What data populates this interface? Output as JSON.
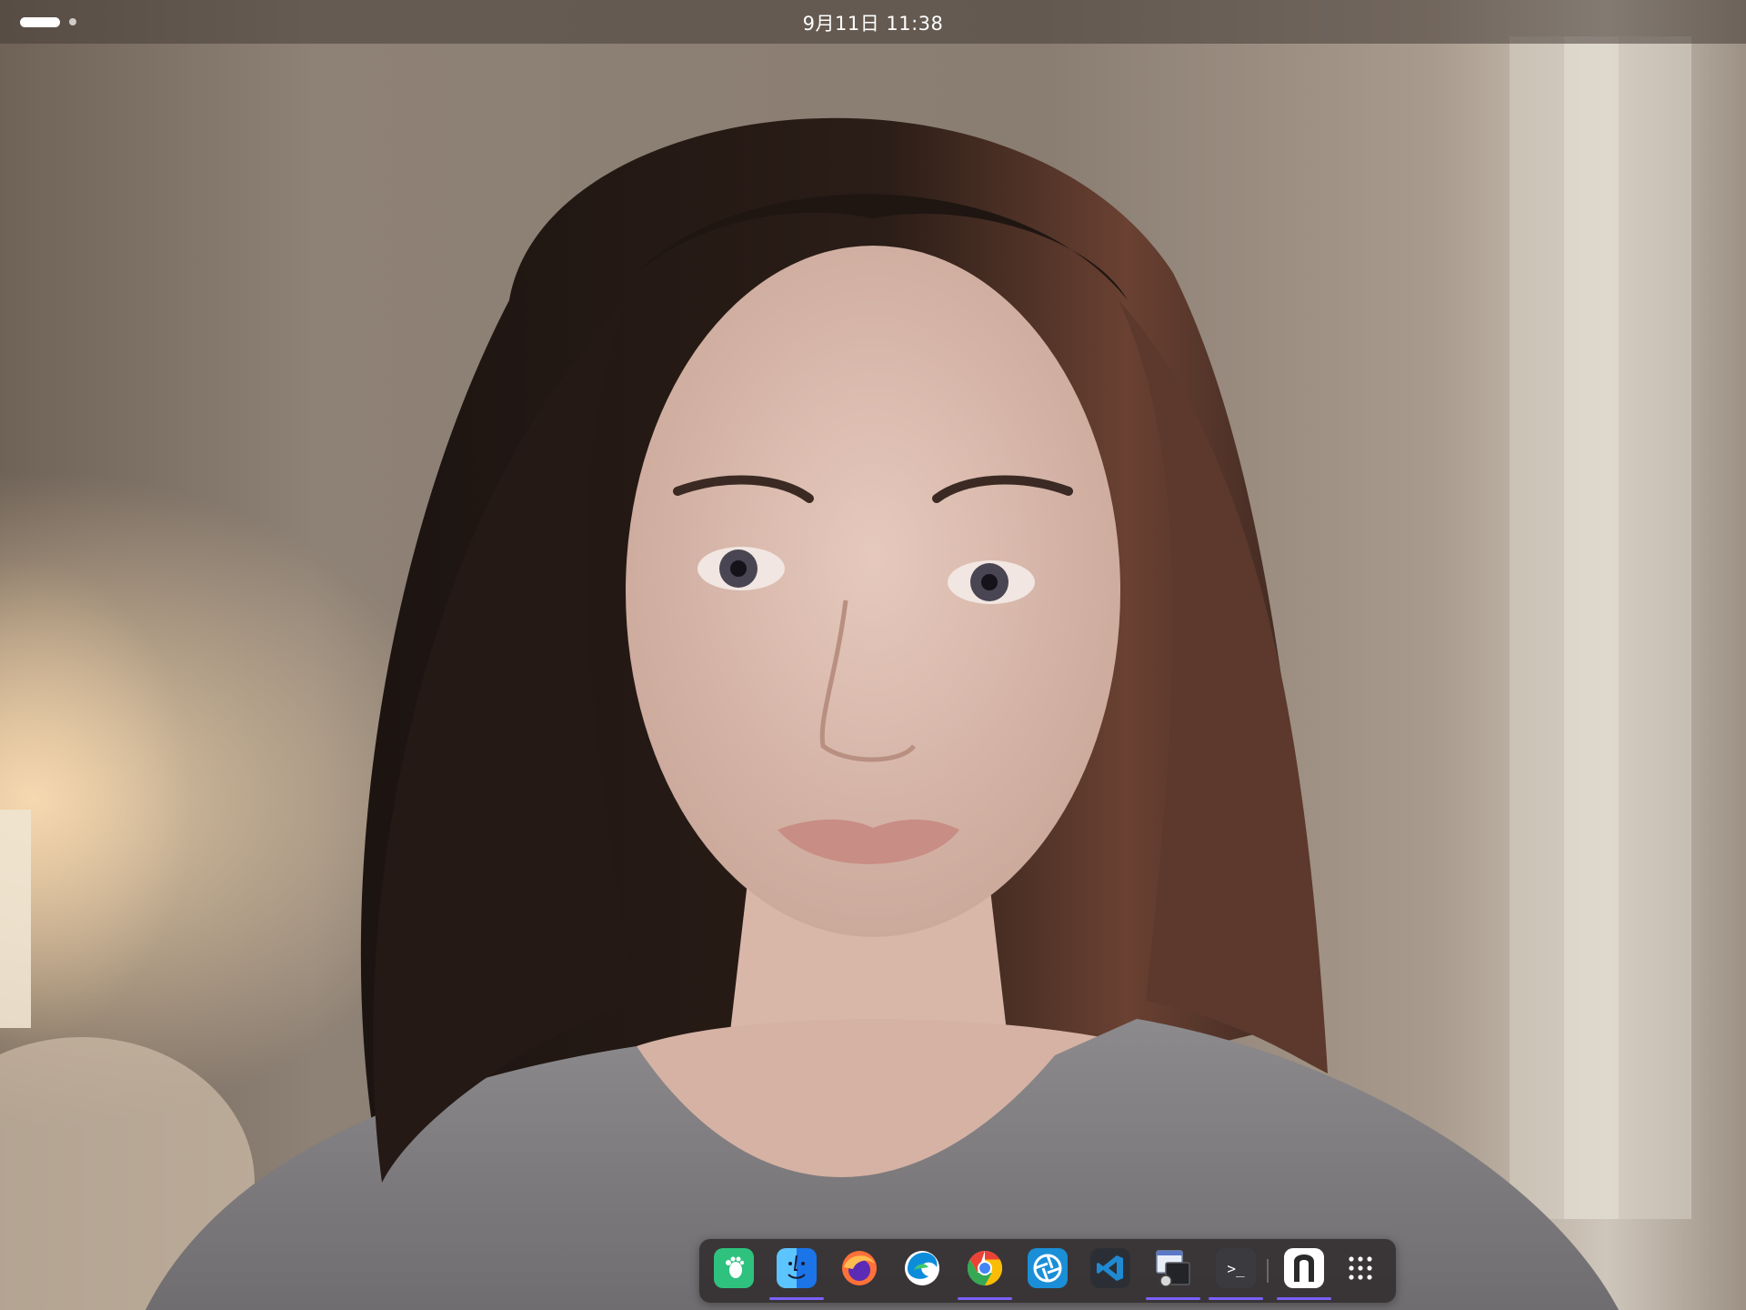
{
  "topbar": {
    "clock": "9月11日  11:38",
    "workspaces": {
      "active": 1,
      "total": 2
    }
  },
  "wallpaper": {
    "description_icon": "portrait-photo"
  },
  "dock": {
    "items": [
      {
        "id": "gnome-software",
        "icon": "gnome-foot-icon",
        "running": false
      },
      {
        "id": "finder",
        "icon": "finder-face-icon",
        "running": true
      },
      {
        "id": "firefox",
        "icon": "firefox-icon",
        "running": false
      },
      {
        "id": "edge",
        "icon": "edge-icon",
        "running": false
      },
      {
        "id": "chrome",
        "icon": "chrome-icon",
        "running": true
      },
      {
        "id": "shutter",
        "icon": "shutter-aperture-icon",
        "running": false
      },
      {
        "id": "vscode",
        "icon": "vscode-icon",
        "running": false
      },
      {
        "id": "window-manager",
        "icon": "window-stack-icon",
        "running": true
      },
      {
        "id": "terminal",
        "icon": "terminal-icon",
        "running": true
      },
      {
        "id": "typora",
        "icon": "typora-icon",
        "running": true
      },
      {
        "id": "app-grid",
        "icon": "grid-icon",
        "running": false
      }
    ],
    "terminal_glyph": ">_",
    "indicator_color": "#7b61ff"
  },
  "colors": {
    "topbar_bg": "#463c37",
    "dock_bg": "#2d282a",
    "accent": "#7b61ff"
  }
}
